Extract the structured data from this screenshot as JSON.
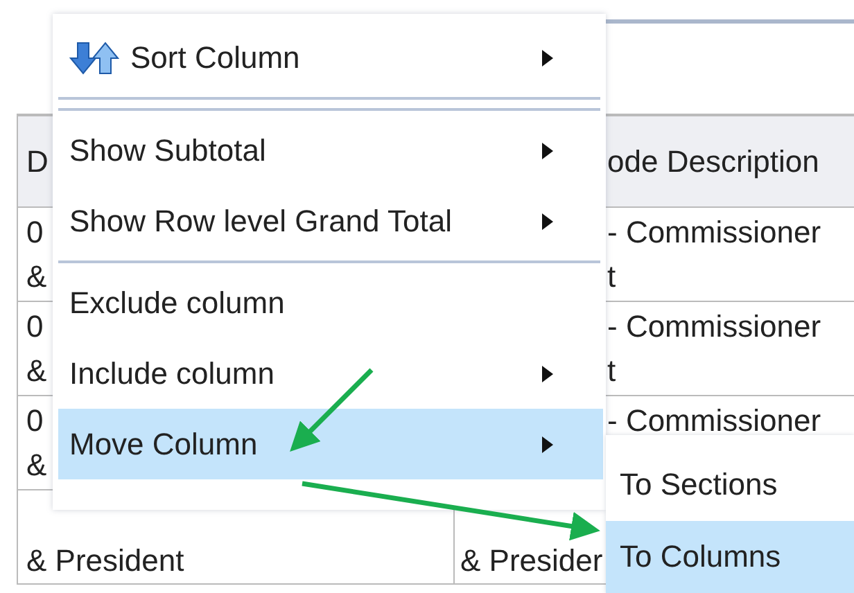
{
  "table": {
    "columns": [
      "D",
      "ode Description"
    ],
    "rows": [
      [
        "0\n&",
        "- Commissioner\nt"
      ],
      [
        "0\n&",
        "- Commissioner\nt"
      ],
      [
        "0\n&",
        "- Commissioner"
      ],
      [
        "& President",
        "& Presider"
      ]
    ]
  },
  "context_menu": {
    "items": [
      {
        "kind": "item",
        "label": "Sort Column",
        "icon": true,
        "has_submenu": true,
        "selected": false
      },
      {
        "kind": "separator"
      },
      {
        "kind": "separator"
      },
      {
        "kind": "item",
        "label": "Show Subtotal",
        "icon": false,
        "has_submenu": true,
        "selected": false
      },
      {
        "kind": "item",
        "label": "Show Row level Grand Total",
        "icon": false,
        "has_submenu": true,
        "selected": false
      },
      {
        "kind": "separator"
      },
      {
        "kind": "item",
        "label": "Exclude column",
        "icon": false,
        "has_submenu": false,
        "selected": false
      },
      {
        "kind": "item",
        "label": "Include column",
        "icon": false,
        "has_submenu": true,
        "selected": false
      },
      {
        "kind": "item",
        "label": "Move Column",
        "icon": false,
        "has_submenu": true,
        "selected": true
      }
    ]
  },
  "submenu": {
    "items": [
      {
        "label": "To Sections",
        "selected": false
      },
      {
        "label": "To Columns",
        "selected": true
      }
    ]
  }
}
